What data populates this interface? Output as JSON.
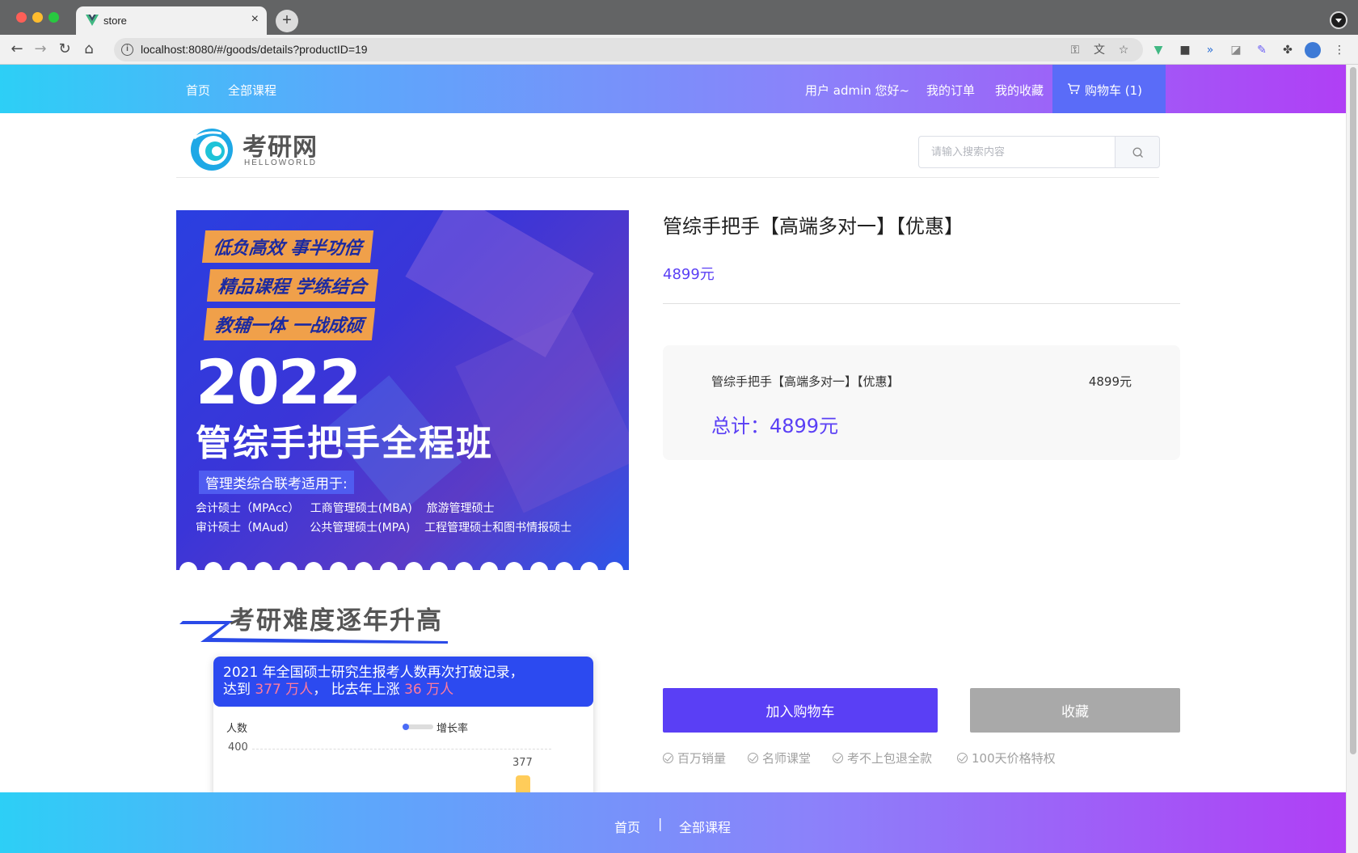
{
  "browser": {
    "tab_title": "store",
    "tab_close": "×",
    "new_tab": "+",
    "url": "localhost:8080/#/goods/details?productID=19"
  },
  "topnav": {
    "home": "首页",
    "all_courses": "全部课程",
    "greeting": "用户 admin 您好~",
    "my_orders": "我的订单",
    "my_favorites": "我的收藏",
    "cart": "购物车 (1)"
  },
  "header": {
    "logo_title": "考研网",
    "logo_subtitle": "HELLOWORLD",
    "search_placeholder": "请输入搜索内容"
  },
  "poster": {
    "stripe1": "低负高效 事半功倍",
    "stripe2": "精品课程 学练结合",
    "stripe3": "教辅一体 一战成硕",
    "year": "2022",
    "course": "管综手把手全程班",
    "tag": "管理类综合联考适用于:",
    "line1": "会计硕士（MPAcc）   工商管理硕士(MBA)    旅游管理硕士",
    "line2": "审计硕士（MAud）    公共管理硕士(MPA)    工程管理硕士和图书情报硕士",
    "section_title": "考研难度逐年升高",
    "card_line1": "2021 年全国硕士研究生报考人数再次打破记录，",
    "card_line2_a": "达到 ",
    "card_line2_b": "377 万人",
    "card_line2_c": "，  比去年上涨 ",
    "card_line2_d": "36 万人",
    "chart_y_label": "人数",
    "chart_legend": "增长率",
    "chart_tick": "400",
    "chart_value": "377"
  },
  "product": {
    "title": "管综手把手【高端多对一】【优惠】",
    "price": "4899元",
    "summary_name": "管综手把手【高端多对一】【优惠】",
    "summary_price": "4899元",
    "total": "总计：4899元",
    "add_to_cart": "加入购物车",
    "favorite": "收藏",
    "services": [
      "百万销量",
      "名师课堂",
      "考不上包退全款",
      "100天价格特权"
    ]
  },
  "footer": {
    "home": "首页",
    "separator": "|",
    "all_courses": "全部课程"
  },
  "colors": {
    "accent": "#5a3ff5",
    "nav_gradient_start": "#2dcff6",
    "nav_gradient_end": "#b03ff5"
  }
}
